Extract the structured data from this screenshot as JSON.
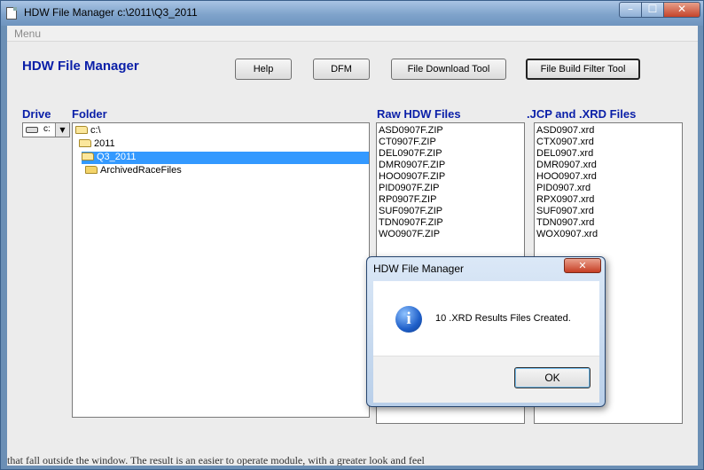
{
  "window": {
    "title": "HDW File Manager c:\\2011\\Q3_2011",
    "min_glyph": "–",
    "max_glyph": "☐",
    "close_glyph": "✕"
  },
  "menu": {
    "items": [
      "Menu"
    ]
  },
  "app": {
    "heading": "HDW File Manager"
  },
  "toolbar": {
    "help": "Help",
    "dfm": "DFM",
    "file_download": "File Download Tool",
    "file_build_filter": "File Build Filter Tool"
  },
  "labels": {
    "drive": "Drive",
    "folder": "Folder",
    "raw_files": "Raw HDW Files",
    "jcp_files": ".JCP and .XRD Files"
  },
  "drive": {
    "value": "c:",
    "arrow": "▼"
  },
  "folders": [
    {
      "name": "c:\\",
      "level": 0,
      "selected": false
    },
    {
      "name": "2011",
      "level": 1,
      "selected": false
    },
    {
      "name": "Q3_2011",
      "level": 2,
      "selected": true
    },
    {
      "name": "ArchivedRaceFiles",
      "level": 3,
      "selected": false
    }
  ],
  "raw_files": [
    "ASD0907F.ZIP",
    "CT0907F.ZIP",
    "DEL0907F.ZIP",
    "DMR0907F.ZIP",
    "HOO0907F.ZIP",
    "PID0907F.ZIP",
    "RP0907F.ZIP",
    "SUF0907F.ZIP",
    "TDN0907F.ZIP",
    "WO0907F.ZIP"
  ],
  "jcp_files": [
    "ASD0907.xrd",
    "CTX0907.xrd",
    "DEL0907.xrd",
    "DMR0907.xrd",
    "HOO0907.xrd",
    "PID0907.xrd",
    "RPX0907.xrd",
    "SUF0907.xrd",
    "TDN0907.xrd",
    "WOX0907.xrd"
  ],
  "dialog": {
    "title": "HDW File Manager",
    "close_glyph": "✕",
    "icon_glyph": "i",
    "message": "10 .XRD Results Files Created.",
    "ok": "OK"
  },
  "background_text": "that fall outside the window. The result is an easier to operate module, with a greater look and feel"
}
